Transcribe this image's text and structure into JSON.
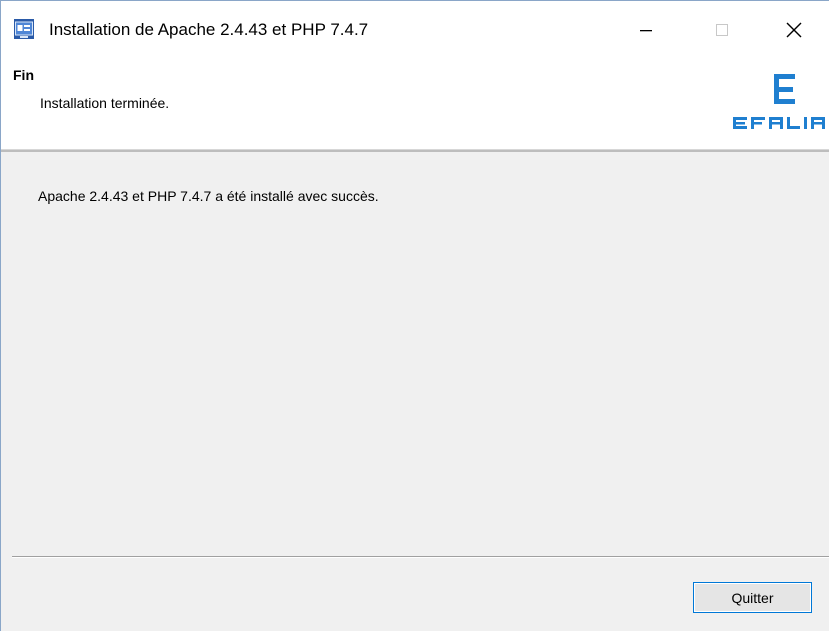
{
  "window": {
    "title": "Installation de Apache 2.4.43 et PHP 7.4.7",
    "app_icon": "installer-app-icon",
    "controls": {
      "minimize_icon": "minimize-icon",
      "maximize_icon": "maximize-icon",
      "close_icon": "close-icon"
    }
  },
  "header": {
    "title": "Fin",
    "subtitle": "Installation terminée.",
    "brand_logo": "efalia-logo",
    "brand_text": "EFALIA",
    "brand_color": "#1f7fd0"
  },
  "content": {
    "message": "Apache 2.4.43 et PHP 7.4.7 a été installé avec succès."
  },
  "footer": {
    "quit_label": "Quitter"
  },
  "colors": {
    "accent": "#0078d7",
    "panel_bg": "#f0f0f0",
    "header_bg": "#ffffff"
  }
}
